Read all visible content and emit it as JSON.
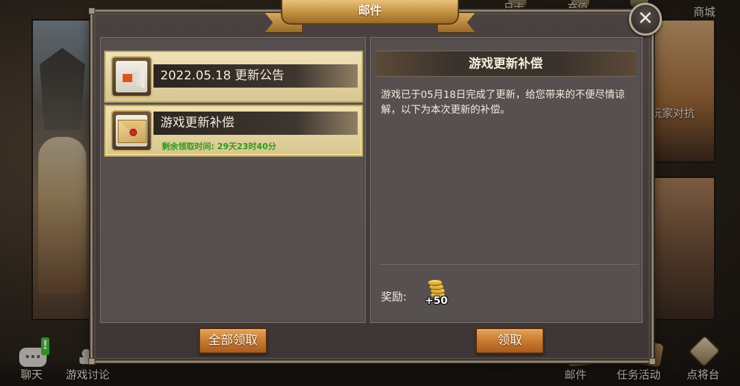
{
  "dialog": {
    "title": "邮件",
    "close_label": "✕"
  },
  "mail_list": [
    {
      "title": "2022.05.18 更新公告",
      "icon": "megaphone-icon",
      "subtitle": ""
    },
    {
      "title": "游戏更新补偿",
      "icon": "envelope-icon",
      "subtitle": "剩余领取时间: 29天23时40分"
    }
  ],
  "detail": {
    "title": "游戏更新补偿",
    "body": "游戏已于05月18日完成了更新，给您带来的不便尽情谅解，以下为本次更新的补偿。",
    "reward_label": "奖励:",
    "reward_icon": "gold-coins-icon",
    "reward_count": "+50"
  },
  "buttons": {
    "claim_all": "全部领取",
    "claim": "领取"
  },
  "background": {
    "top_nav": [
      "日卡",
      "充值",
      "",
      "商城"
    ],
    "side_label": "玩家对抗",
    "bottom_nav": [
      "聊天",
      "游戏讨论",
      "邮件",
      "任务活动",
      "点将台"
    ],
    "alert_badge": "!"
  }
}
